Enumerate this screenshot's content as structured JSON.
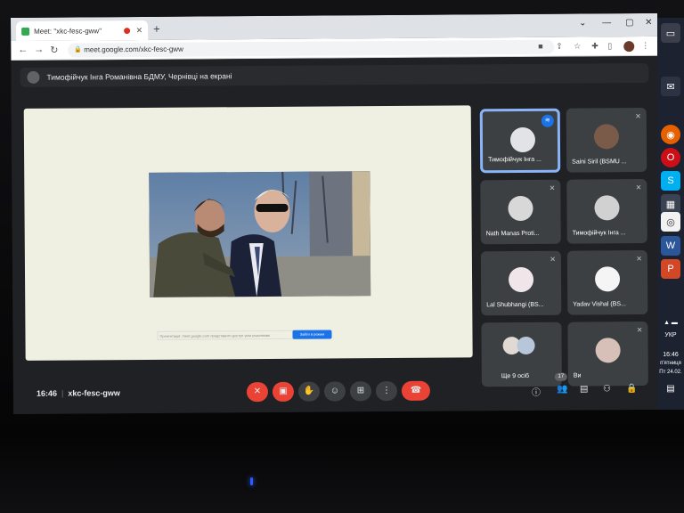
{
  "browser": {
    "tab_title": "Meet: \"xkc-fesc-gww\"",
    "new_tab": "+",
    "url": "meet.google.com/xkc-fesc-gww",
    "minimize": "⌄",
    "maximize": "—",
    "restore": "▢",
    "close": "✕"
  },
  "meet": {
    "presenter_text": "Тимофійчук Інга Романівна БДМУ, Чернівці на екрані",
    "stage_hint": "Презентація: meet.google.com представити доступ усім учасникам",
    "stage_button": "Зайти в режим",
    "participants": [
      {
        "name": "Тимофійчук Інга ...",
        "active": true
      },
      {
        "name": "Saini Siril (BSMU ..."
      },
      {
        "name": "Nath Manas Proti..."
      },
      {
        "name": "Тимофійчук Інга ..."
      },
      {
        "name": "Lal Shubhangi (BS..."
      },
      {
        "name": "Yadav Vishal (BS..."
      },
      {
        "name": "Ще 9 осіб"
      },
      {
        "name": "Ви"
      }
    ],
    "time": "16:46",
    "meeting_code": "xkc-fesc-gww",
    "participant_count": "17"
  },
  "taskbar": {
    "lang": "УКР",
    "time": "16:46",
    "day": "п'ятниця",
    "date": "Пт 24.02."
  },
  "colors": {
    "accent": "#8ab4f8",
    "danger": "#ea4335",
    "meet_bg": "#202124",
    "tile_bg": "#3c4043"
  }
}
